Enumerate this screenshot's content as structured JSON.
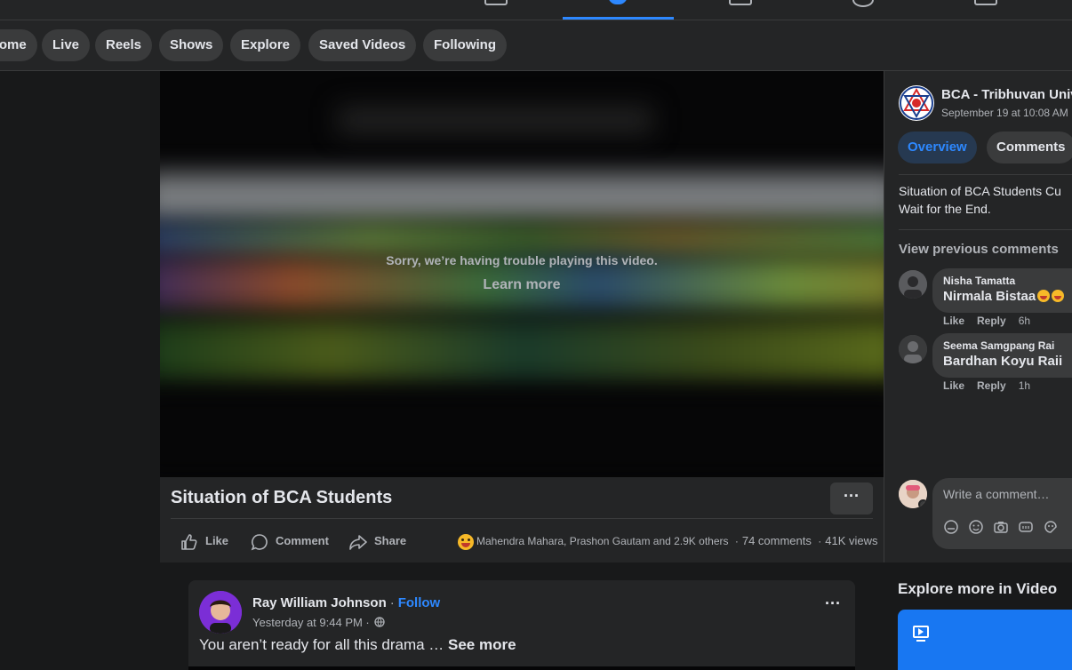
{
  "pills": [
    "Home",
    "Live",
    "Reels",
    "Shows",
    "Explore",
    "Saved Videos",
    "Following"
  ],
  "video": {
    "error_message": "Sorry, we’re having trouble playing this video.",
    "learn_more": "Learn more",
    "title": "Situation of BCA Students",
    "more_label": "···"
  },
  "actions": {
    "like": "Like",
    "comment": "Comment",
    "share": "Share"
  },
  "stats": {
    "reactors": "Mahendra Mahara, Prashon Gautam and 2.9K others",
    "comments": "74 comments",
    "views": "41K views",
    "dot": "·"
  },
  "side": {
    "page_name": "BCA - Tribhuvan University",
    "date": "September 19 at 10:08 AM",
    "tabs": {
      "overview": "Overview",
      "comments": "Comments"
    },
    "description_line1": "Situation of BCA Students Cu",
    "description_line2": "Wait for the End.",
    "view_previous": "View previous comments",
    "comments": [
      {
        "author": "Nisha Tamatta",
        "text": "Nirmala Bistaa",
        "like": "Like",
        "reply": "Reply",
        "time": "6h"
      },
      {
        "author": "Seema Samgpang Rai",
        "text": "Bardhan Koyu Raii",
        "like": "Like",
        "reply": "Reply",
        "time": "1h"
      }
    ],
    "composer_placeholder": "Write a comment…"
  },
  "post": {
    "author": "Ray William Johnson",
    "separator": "·",
    "follow": "Follow",
    "date": "Yesterday at 9:44 PM ·",
    "text": "You aren’t ready for all this drama … ",
    "see_more": "See more",
    "more_label": "···"
  },
  "explore_title": "Explore more in Video",
  "colors": {
    "accent": "#2d88ff",
    "card": "#1877f2",
    "bg": "#18191a",
    "surface": "#242526"
  }
}
